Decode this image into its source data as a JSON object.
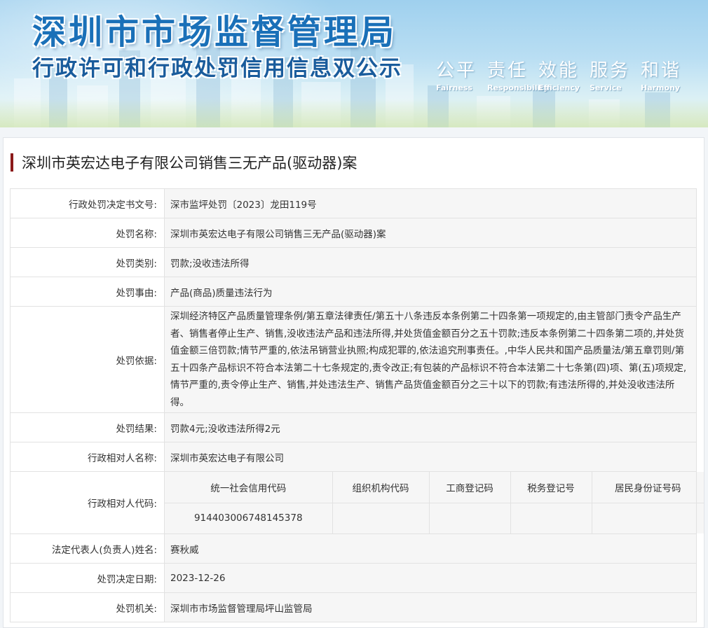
{
  "banner": {
    "title": "深圳市市场监督管理局",
    "subtitle": "行政许可和行政处罚信用信息双公示",
    "slogans": [
      {
        "cn": "公平",
        "en": "Fairness"
      },
      {
        "cn": "责任",
        "en": "Responsibility"
      },
      {
        "cn": "效能",
        "en": "Efficiency"
      },
      {
        "cn": "服务",
        "en": "Service"
      },
      {
        "cn": "和谐",
        "en": "Harmony"
      }
    ]
  },
  "heading": "深圳市英宏达电子有限公司销售三无产品(驱动器)案",
  "rows": {
    "doc_no": {
      "label": "行政处罚决定书文号:",
      "value": "深市监坪处罚〔2023〕龙田119号"
    },
    "name": {
      "label": "处罚名称:",
      "value": "深圳市英宏达电子有限公司销售三无产品(驱动器)案"
    },
    "category": {
      "label": "处罚类别:",
      "value": "罚款;没收违法所得"
    },
    "reason": {
      "label": "处罚事由:",
      "value": "产品(商品)质量违法行为"
    },
    "basis": {
      "label": "处罚依据:",
      "value": "深圳经济特区产品质量管理条例/第五章法律责任/第五十八条违反本条例第二十四条第一项规定的,由主管部门责令产品生产者、销售者停止生产、销售,没收违法产品和违法所得,并处货值金额百分之五十罚款;违反本条例第二十四条第二项的,并处货值金额三倍罚款;情节严重的,依法吊销营业执照;构成犯罪的,依法追究刑事责任。,中华人民共和国产品质量法/第五章罚则/第五十四条产品标识不符合本法第二十七条规定的,责令改正;有包装的产品标识不符合本法第二十七条第(四)项、第(五)项规定,情节严重的,责令停止生产、销售,并处违法生产、销售产品货值金额百分之三十以下的罚款;有违法所得的,并处没收违法所得。"
    },
    "result": {
      "label": "处罚结果:",
      "value": "罚款4元;没收违法所得2元"
    },
    "party_name": {
      "label": "行政相对人名称:",
      "value": "深圳市英宏达电子有限公司"
    },
    "party_code": {
      "label": "行政相对人代码:",
      "headers": [
        "统一社会信用代码",
        "组织机构代码",
        "工商登记码",
        "税务登记号",
        "居民身份证号码"
      ],
      "values": [
        "914403006748145378",
        "",
        "",
        "",
        ""
      ]
    },
    "legal_rep": {
      "label": "法定代表人(负责人)姓名:",
      "value": "赛秋威"
    },
    "date": {
      "label": "处罚决定日期:",
      "value": "2023-12-26"
    },
    "authority": {
      "label": "处罚机关:",
      "value": "深圳市市场监督管理局坪山监管局"
    }
  }
}
